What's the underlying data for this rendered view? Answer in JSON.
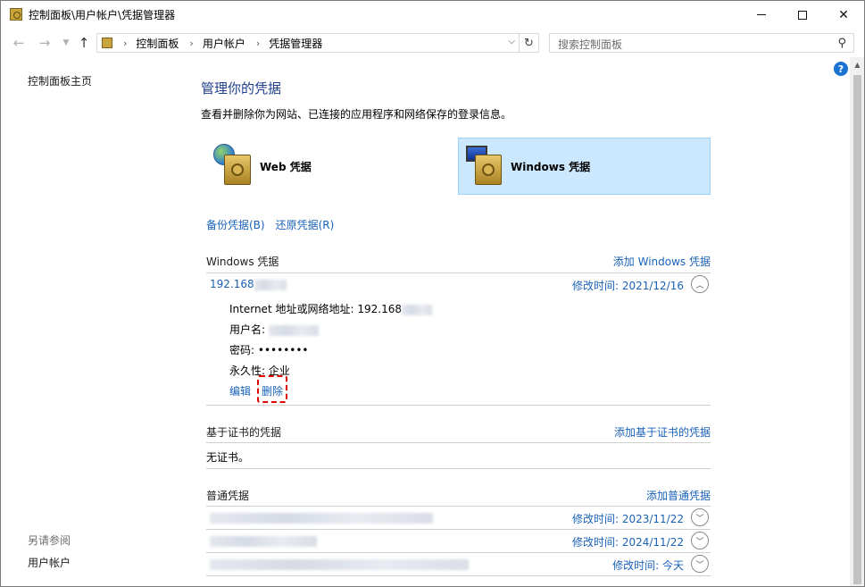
{
  "window": {
    "title": "控制面板\\用户帐户\\凭据管理器"
  },
  "nav": {
    "breadcrumbs": [
      "控制面板",
      "用户帐户",
      "凭据管理器"
    ],
    "search_placeholder": "搜索控制面板"
  },
  "sidebar": {
    "home": "控制面板主页",
    "see_also": "另请参阅",
    "user_accounts": "用户帐户"
  },
  "main": {
    "heading": "管理你的凭据",
    "description": "查看并删除你为网站、已连接的应用程序和网络保存的登录信息。",
    "web_credentials": "Web 凭据",
    "windows_credentials": "Windows 凭据",
    "backup": "备份凭据(B)",
    "restore": "还原凭据(R)"
  },
  "windows_section": {
    "title": "Windows 凭据",
    "add": "添加 Windows 凭据",
    "entry": {
      "name": "192.168",
      "modified": "修改时间: 2021/12/16",
      "address_label": "Internet 地址或网络地址:",
      "address_value": "192.168",
      "username_label": "用户名:",
      "password_label": "密码:",
      "password_value": "••••••••",
      "persistence_label": "永久性:",
      "persistence_value": "企业",
      "edit": "编辑",
      "delete": "删除"
    }
  },
  "cert_section": {
    "title": "基于证书的凭据",
    "add": "添加基于证书的凭据",
    "empty": "无证书。"
  },
  "generic_section": {
    "title": "普通凭据",
    "add": "添加普通凭据",
    "rows": [
      {
        "modified": "修改时间: 2023/11/22"
      },
      {
        "modified": "修改时间: 2024/11/22"
      },
      {
        "modified": "修改时间: 今天"
      }
    ]
  },
  "colors": {
    "link": "#1a62b8",
    "heading": "#1e3e8a",
    "selected_bg": "#cce8ff",
    "highlight": "#e10000"
  }
}
